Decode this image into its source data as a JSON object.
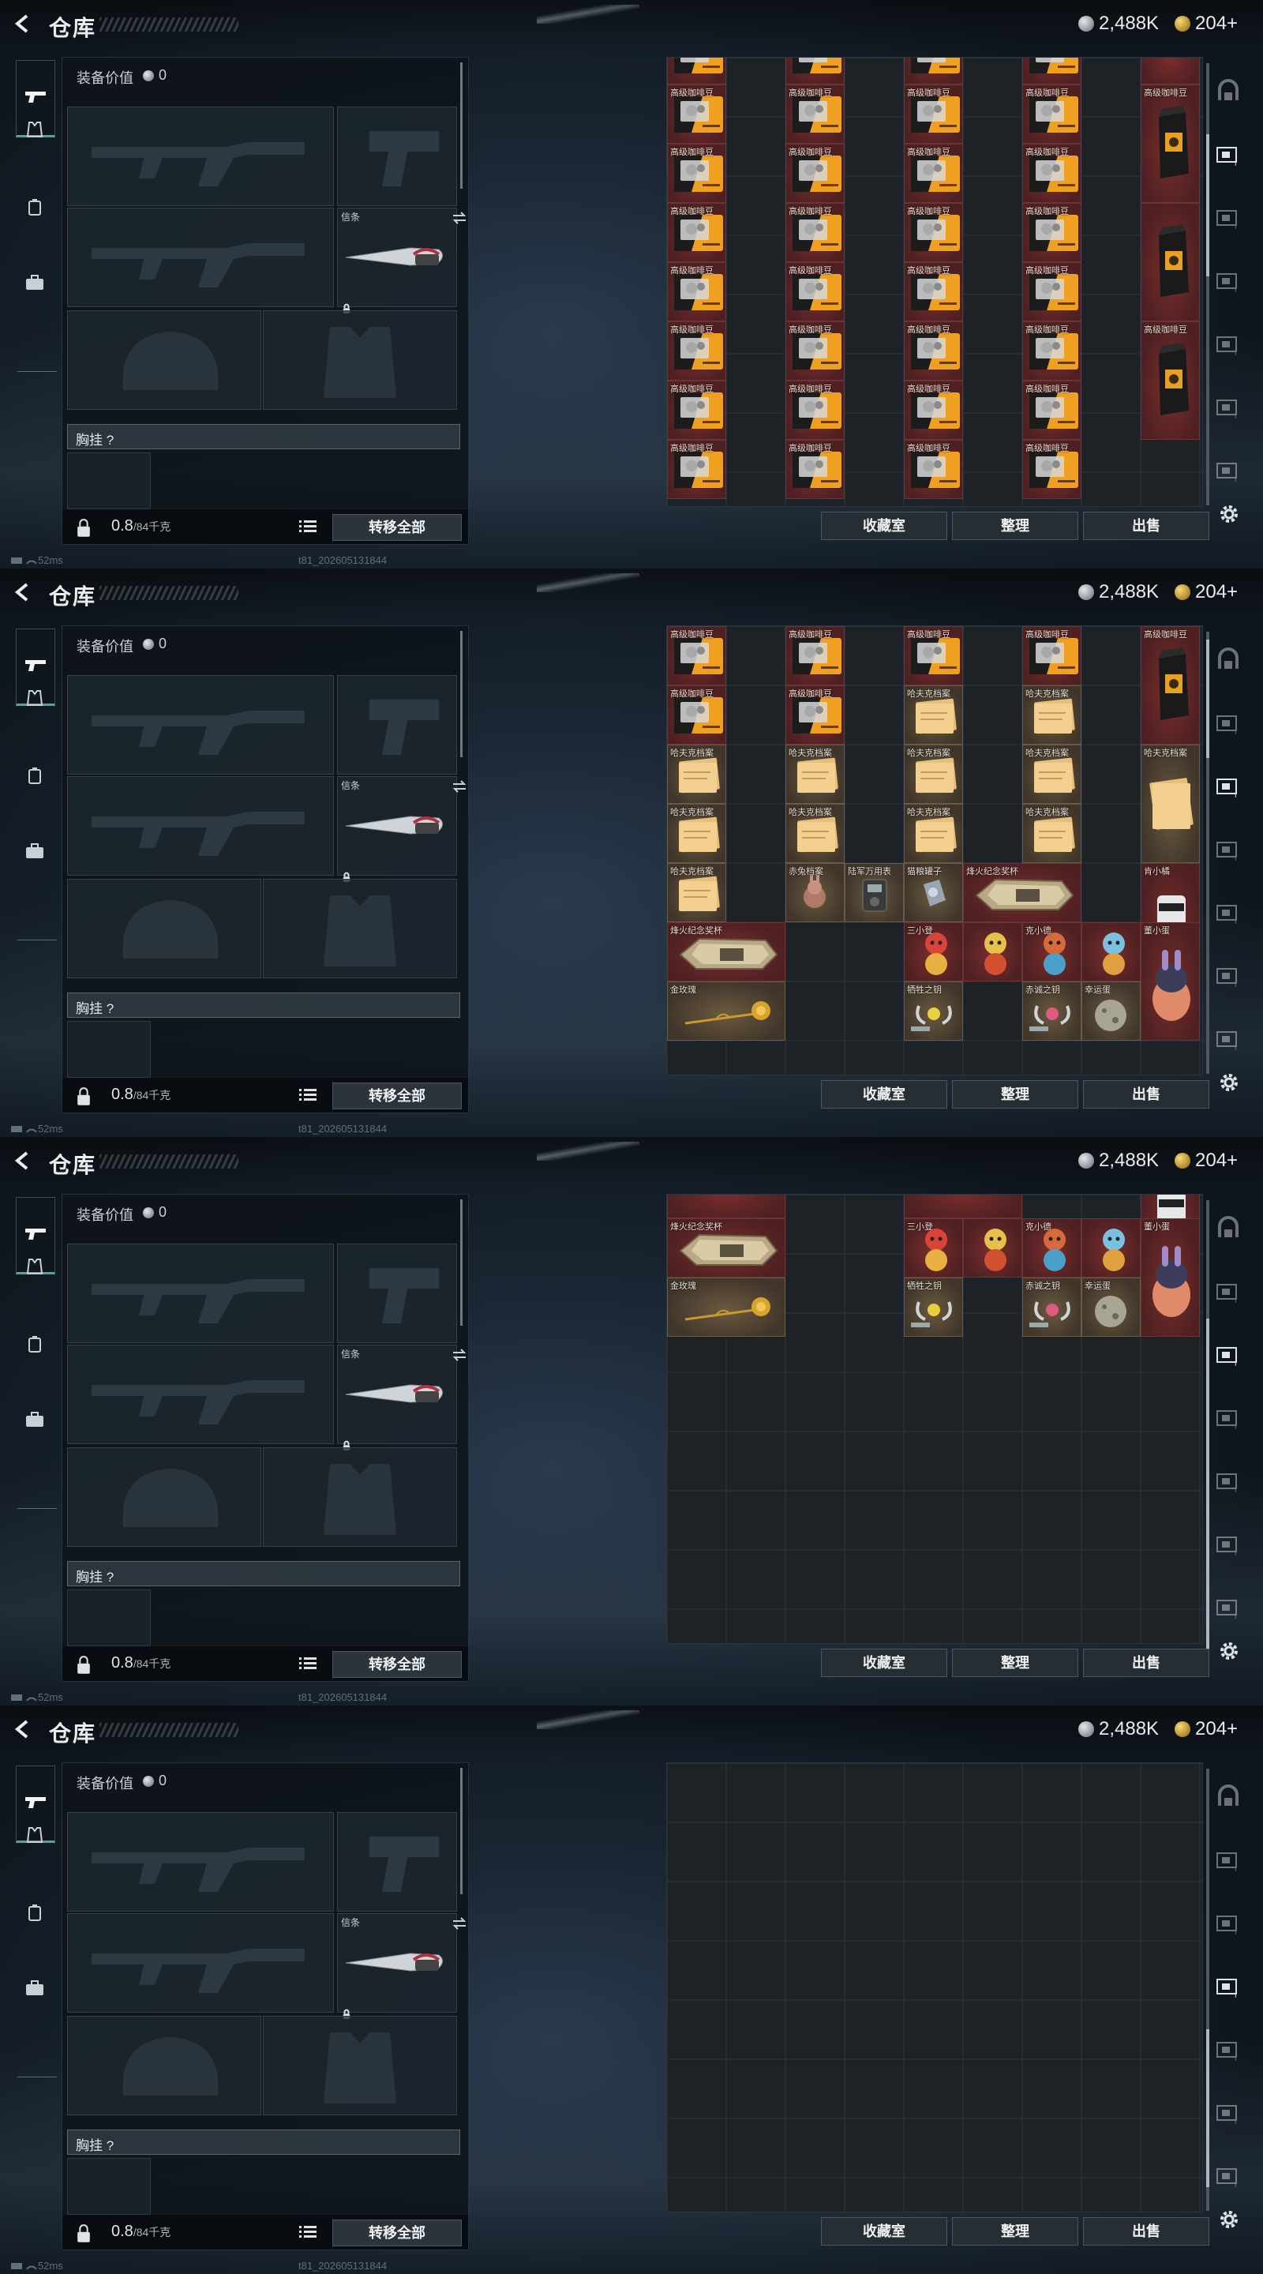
{
  "app": {
    "title": "仓库",
    "silver_amount": "2,488K",
    "gold_amount": "204+",
    "version_hint": ""
  },
  "loadout": {
    "equipment_value_label": "装备价值",
    "equipment_value": "0",
    "melee_caption": "信条",
    "chest_rig_label": "胸挂 ?",
    "weight_value": "0.8",
    "weight_unit": "/84千克",
    "transfer_all_label": "转移全部"
  },
  "storage": {
    "buttons": {
      "collection": "收藏室",
      "organize": "整理",
      "sell": "出售"
    },
    "item_names": {
      "coffee": "高级咖啡豆",
      "havoc_file": "哈夫克档案",
      "rabbit_file": "赤兔档案",
      "universal_meter": "陆军万用表",
      "cat_can": "猫粮罐子",
      "beacon_trophy": "烽火纪念奖杯",
      "xiao_ju": "肯小橘",
      "xiao_san": "三小登",
      "ke_xiao": "克小德",
      "dong_xiao": "董小蛋",
      "gold_rose": "金玫瑰",
      "sacrifice_key": "牺牲之钥",
      "loyal_key": "赤诚之钥",
      "lucky_egg": "幸运蛋"
    },
    "frames": [
      {
        "cells": [
          {
            "label": "高级咖啡豆"
          },
          {
            "label": "高级咖啡豆"
          },
          {
            "label": "高级咖啡豆"
          },
          {
            "label": "高级咖啡豆"
          },
          {
            "label": "高级咖啡豆"
          }
        ]
      }
    ]
  },
  "status_bar": {
    "ping": "52ms",
    "build": "t81_202605131844"
  },
  "icons": {
    "back": "chevron-left-icon",
    "weapon_tab": "gun-icon",
    "armor_tab": "vest-icon",
    "backpack_tab": "backpack-icon",
    "case_tab": "briefcase-icon",
    "lock": "lock-icon",
    "list": "list-icon",
    "swap": "swap-icon",
    "settings": "gear-icon",
    "silver_coin": "silver-coin-icon",
    "gold_coin": "gold-coin-icon"
  },
  "colors": {
    "accent_green": "#3fb28c",
    "cell_red": "#5a2426",
    "cell_gold": "#4a3d2e",
    "panel_bg": "#0e1319"
  }
}
